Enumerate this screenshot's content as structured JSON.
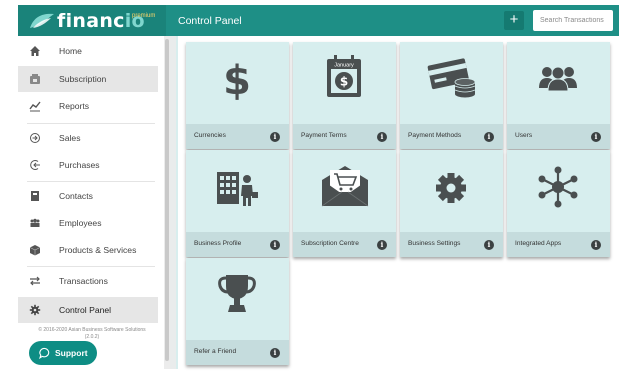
{
  "app": {
    "logo_text_1": "financ",
    "logo_text_2": "io",
    "logo_badge": "premium",
    "title": "Control Panel",
    "add_label": "+",
    "search_placeholder": "Search Transactions"
  },
  "sidebar": {
    "items": [
      {
        "label": "Home",
        "icon": "home-icon"
      },
      {
        "label": "Subscription",
        "icon": "subscription-icon",
        "active": true
      },
      {
        "label": "Reports",
        "icon": "chart-line-icon"
      },
      {
        "label": "Sales",
        "icon": "sales-icon"
      },
      {
        "label": "Purchases",
        "icon": "purchases-icon"
      },
      {
        "label": "Contacts",
        "icon": "contacts-book-icon"
      },
      {
        "label": "Employees",
        "icon": "employees-icon"
      },
      {
        "label": "Products & Services",
        "icon": "box-icon"
      },
      {
        "label": "Transactions",
        "icon": "transactions-icon"
      },
      {
        "label": "Control Panel",
        "icon": "gear-icon",
        "active": true
      }
    ],
    "copyright": "© 2016-2020 Asian Business Software Solutions",
    "version": "(2.0.2)",
    "support_label": "Support"
  },
  "tiles": [
    {
      "label": "Currencies",
      "icon": "dollar-icon"
    },
    {
      "label": "Payment Terms",
      "icon": "calendar-dollar-icon",
      "calendar_text": "January"
    },
    {
      "label": "Payment Methods",
      "icon": "credit-card-coins-icon"
    },
    {
      "label": "Users",
      "icon": "users-icon"
    },
    {
      "label": "Business Profile",
      "icon": "business-building-icon"
    },
    {
      "label": "Subscription Centre",
      "icon": "cart-envelope-icon"
    },
    {
      "label": "Business Settings",
      "icon": "gear-icon"
    },
    {
      "label": "Integrated Apps",
      "icon": "network-nodes-icon"
    },
    {
      "label": "Refer a Friend",
      "icon": "trophy-icon"
    }
  ],
  "info_glyph": "i",
  "colors": {
    "header": "#1e8f86",
    "accent": "#0e8d84",
    "tile_bg": "#d7eeee",
    "tile_footer": "#c5dcdd",
    "icon": "#4a4f50"
  }
}
